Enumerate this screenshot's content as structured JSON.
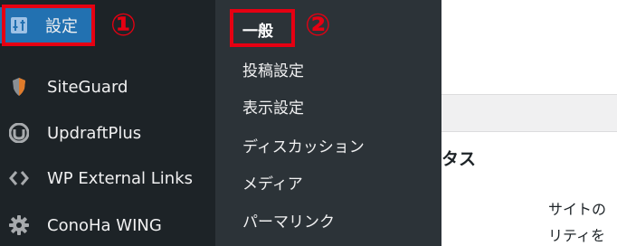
{
  "sidebar": {
    "settings": {
      "label": "設定",
      "icon": "settings-sliders-icon",
      "annotation": "①"
    },
    "items": [
      {
        "label": "SiteGuard",
        "icon": "siteguard-shield-icon"
      },
      {
        "label": "UpdraftPlus",
        "icon": "updraftplus-icon"
      },
      {
        "label": "WP External Links",
        "icon": "code-brackets-icon"
      },
      {
        "label": "ConoHa WING",
        "icon": "gear-icon"
      }
    ]
  },
  "submenu": {
    "items": [
      {
        "label": "一般",
        "annotation": "②"
      },
      {
        "label": "投稿設定"
      },
      {
        "label": "表示設定"
      },
      {
        "label": "ディスカッション"
      },
      {
        "label": "メディア"
      },
      {
        "label": "パーマリンク"
      }
    ]
  },
  "main": {
    "heading": "タス",
    "text_line1": "サイトの",
    "text_line2": "リティを"
  },
  "colors": {
    "sidebar_bg": "#1d2327",
    "submenu_bg": "#2c3338",
    "active_bg": "#2271b1",
    "annotation_red": "#e60012"
  }
}
